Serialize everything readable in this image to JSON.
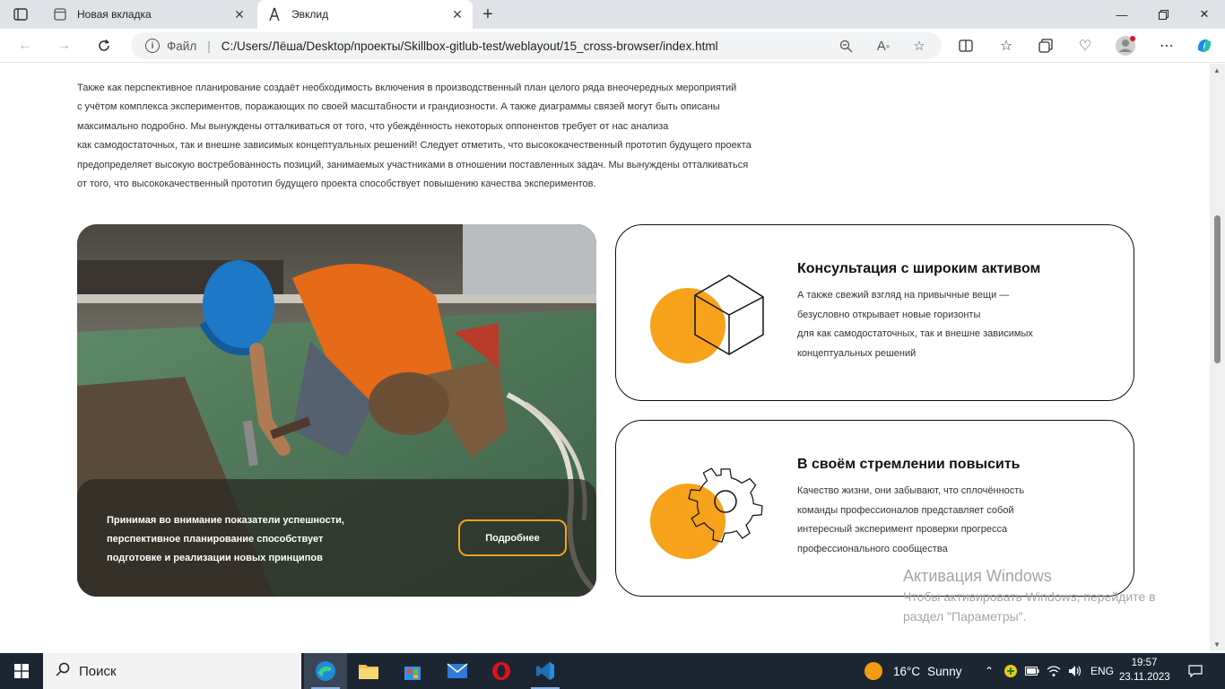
{
  "browser": {
    "tabs": [
      {
        "title": "Новая вкладка",
        "active": false
      },
      {
        "title": "Эвклид",
        "active": true
      }
    ],
    "address": {
      "scheme_label": "Файл",
      "url": "C:/Users/Лёша/Desktop/проекты/Skillbox-gitlub-test/weblayout/15_cross-browser/index.html"
    }
  },
  "page": {
    "intro_lines": [
      "Также как перспективное планирование создаёт необходимость включения в производственный план целого ряда внеочередных мероприятий",
      "с учётом комплекса экспериментов, поражающих по своей масштабности и грандиозности. А также диаграммы связей могут быть описаны",
      "максимально подробно. Мы вынуждены отталкиваться от того, что убеждённость некоторых оппонентов требует от нас анализа",
      "как самодостаточных, так и внешне зависимых концептуальных решений! Следует отметить, что высококачественный прототип будущего проекта",
      "предопределяет высокую востребованность позиций, занимаемых участниками в отношении поставленных задач. Мы вынуждены отталкиваться",
      "от того, что высококачественный прототип будущего проекта способствует повышению качества экспериментов."
    ],
    "hero": {
      "caption_lines": [
        "Принимая во внимание показатели успешности,",
        "перспективное планирование способствует",
        "подготовке и реализации новых принципов"
      ],
      "button_label": "Подробнее"
    },
    "cards": [
      {
        "title": "Консультация с широким активом",
        "text_lines": [
          "А также свежий взгляд на привычные вещи —",
          "безусловно открывает новые горизонты",
          "для как самодостаточных, так и внешне зависимых",
          "концептуальных решений"
        ]
      },
      {
        "title": "В своём стремлении повысить",
        "text_lines": [
          "Качество жизни, они забывают, что сплочённость",
          "команды профессионалов представляет собой",
          "интересный эксперимент проверки прогресса",
          "профессионального сообщества"
        ]
      }
    ],
    "accent_color": "#f7a21b"
  },
  "watermark": {
    "title": "Активация Windows",
    "line1": "Чтобы активировать Windows, перейдите в",
    "line2": "раздел \"Параметры\"."
  },
  "taskbar": {
    "search_label": "Поиск",
    "weather": {
      "temp": "16°C",
      "condition": "Sunny"
    },
    "lang": "ENG",
    "time": "19:57",
    "date": "23.11.2023"
  }
}
